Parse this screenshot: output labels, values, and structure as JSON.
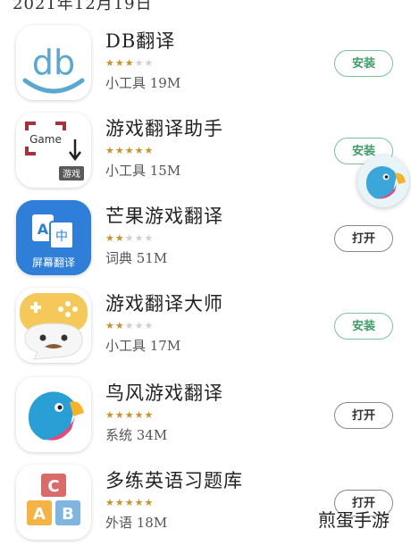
{
  "header": {
    "date_fragment": "2021年12月19日"
  },
  "apps": [
    {
      "name": "DB翻译",
      "rating": 3,
      "meta": "小工具 19M",
      "button": "安装",
      "button_type": "install"
    },
    {
      "name": "游戏翻译助手",
      "rating": 4.5,
      "meta": "小工具 15M",
      "button": "安装",
      "button_type": "install"
    },
    {
      "name": "芒果游戏翻译",
      "rating": 2.5,
      "meta": "词典 51M",
      "button": "打开",
      "button_type": "open",
      "icon_text": "屏幕翻译",
      "icon_letter_a": "A",
      "icon_letter_b": "中"
    },
    {
      "name": "游戏翻译大师",
      "rating": 2.5,
      "meta": "小工具 17M",
      "button": "安装",
      "button_type": "install"
    },
    {
      "name": "鸟风游戏翻译",
      "rating": 4.5,
      "meta": "系统 34M",
      "button": "打开",
      "button_type": "open"
    },
    {
      "name": "多练英语习题库",
      "rating": 4.5,
      "meta": "外语 18M",
      "button": "打开",
      "button_type": "open"
    }
  ],
  "icon_texts": {
    "db": "db",
    "game": "Game",
    "game_tag": "游戏",
    "block_c": "C",
    "block_a": "A",
    "block_b": "B"
  },
  "watermark": "煎蛋手游",
  "colors": {
    "install_green": "#3f9b67",
    "star_gold": "#c8922e",
    "mango_blue": "#2f7fd8"
  },
  "icons": [
    "db-logo",
    "game-translate-logo",
    "mango-translate-logo",
    "game-controller-face-logo",
    "parrot-logo",
    "abc-blocks-logo",
    "floating-parrot-bubble"
  ]
}
